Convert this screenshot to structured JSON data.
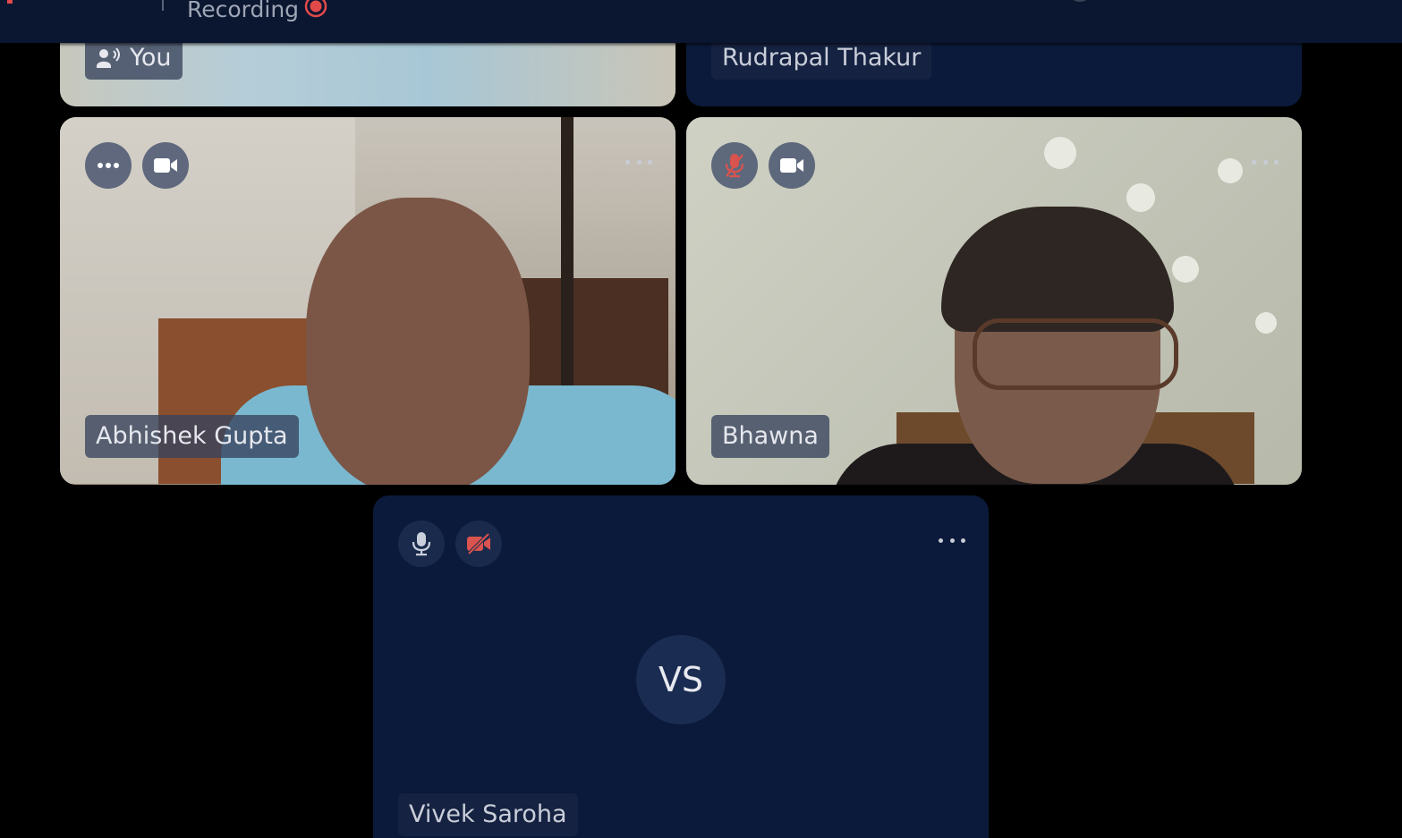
{
  "header": {
    "recording_label": "Recording",
    "recording_color": "#e24a4a"
  },
  "participants": [
    {
      "name": "You",
      "video": true,
      "speaking": true
    },
    {
      "name": "Rudrapal Thakur",
      "video": false
    },
    {
      "name": "Abhishek Gupta",
      "video": true,
      "mic": "more",
      "camera": "on"
    },
    {
      "name": "Bhawna",
      "video": true,
      "mic": "muted",
      "camera": "on"
    },
    {
      "name": "Vivek Saroha",
      "video": false,
      "mic": "on",
      "camera": "off",
      "initials": "VS"
    }
  ],
  "colors": {
    "background": "#000000",
    "tile_dark": "#0b1a3a",
    "muted_red": "#d9534f"
  }
}
